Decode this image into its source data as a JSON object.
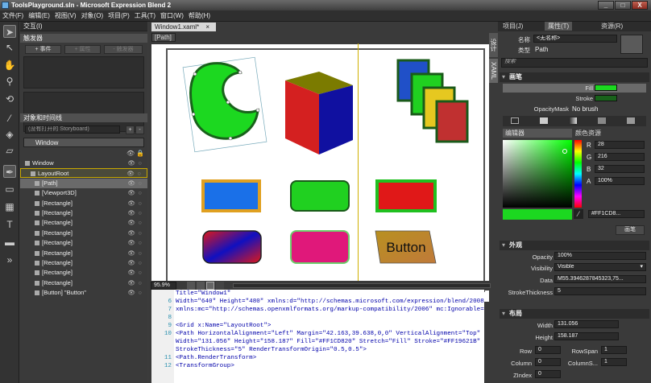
{
  "window": {
    "title": "ToolsPlayground.sln - Microsoft Expression Blend 2",
    "controls": [
      "_",
      "□",
      "X"
    ]
  },
  "menu": [
    "文件(F)",
    "编辑(E)",
    "视图(V)",
    "对象(O)",
    "项目(P)",
    "工具(T)",
    "窗口(W)",
    "帮助(H)"
  ],
  "interaction": {
    "title": "交互(I)",
    "triggers_title": "触发器",
    "event_btn": "+ 事件",
    "property_btn": "+ 属性",
    "delete_btn": "- 触发器",
    "objects_title": "对象和时间线",
    "storyboard_placeholder": "(没有打开的 Storyboard)",
    "window_label": "Window",
    "tree": [
      "Window",
      "LayoutRoot",
      "[Path]",
      "[Viewport3D]",
      "[Rectangle]",
      "[Rectangle]",
      "[Rectangle]",
      "[Rectangle]",
      "[Rectangle]",
      "[Rectangle]",
      "[Rectangle]",
      "[Rectangle]",
      "[Rectangle]",
      "[Button] \"Button\""
    ]
  },
  "document": {
    "tab": "Window1.xaml*",
    "breadcrumb": "[Path]",
    "zoom": "95.9%",
    "side_tabs": [
      "设计",
      "XAML"
    ],
    "button_text": "Button"
  },
  "xaml": {
    "lines": [
      {
        "n": "",
        "t": "Title=\"Window1\""
      },
      {
        "n": "6",
        "t": "Width=\"640\" Height=\"480\" xmlns:d=\"http://schemas.microsoft.com/expression/blend/2008\""
      },
      {
        "n": "7",
        "t": "xmlns:mc=\"http://schemas.openxmlformats.org/markup-compatibility/2006\" mc:Ignorable=\"d\">"
      },
      {
        "n": "8",
        "t": ""
      },
      {
        "n": "9",
        "t": "  <Grid x:Name=\"LayoutRoot\">"
      },
      {
        "n": "10",
        "t": "    <Path HorizontalAlignment=\"Left\" Margin=\"42.163,39.638,0,0\" VerticalAlignment=\"Top\""
      },
      {
        "n": "",
        "t": "Width=\"131.056\" Height=\"158.187\" Fill=\"#FF1CD820\" Stretch=\"Fill\" Stroke=\"#FF19621B\""
      },
      {
        "n": "",
        "t": "StrokeThickness=\"5\" RenderTransformOrigin=\"0.5,0.5\">"
      },
      {
        "n": "11",
        "t": "      <Path.RenderTransform>"
      },
      {
        "n": "12",
        "t": "        <TransformGroup>"
      }
    ]
  },
  "right_tabs": [
    "项目(J)",
    "属性(T)",
    "资源(R)"
  ],
  "properties": {
    "name_label": "名称",
    "name_value": "<无名称>",
    "type_label": "类型",
    "type_value": "Path",
    "search_placeholder": "搜索",
    "brushes": {
      "title": "画笔",
      "fill": "Fill",
      "stroke": "Stroke",
      "opacity_mask": "OpacityMask",
      "opacity_mask_value": "No brush"
    },
    "editor_tab": "编辑器",
    "color_resources_tab": "颜色资源",
    "rgba": [
      {
        "k": "R",
        "v": "28"
      },
      {
        "k": "G",
        "v": "216"
      },
      {
        "k": "B",
        "v": "32"
      },
      {
        "k": "A",
        "v": "100%"
      }
    ],
    "hex": "#FF1CD8...",
    "brush_btn": "画笔",
    "appearance": {
      "title": "外观",
      "opacity_label": "Opacity",
      "opacity_value": "100%",
      "visibility_label": "Visibility",
      "visibility_value": "Visible",
      "data_label": "Data",
      "data_value": "M55.3946287845323,75...",
      "stroke_thickness_label": "StrokeThickness",
      "stroke_thickness_value": "5"
    },
    "layout": {
      "title": "布局",
      "width_label": "Width",
      "width_value": "131.056",
      "height_label": "Height",
      "height_value": "158.187",
      "row_label": "Row",
      "row_value": "0",
      "rowspan_label": "RowSpan",
      "rowspan_value": "1",
      "column_label": "Column",
      "column_value": "0",
      "colspan_label": "ColumnS...",
      "colspan_value": "1",
      "zindex_label": "ZIndex",
      "zindex_value": "0"
    }
  },
  "colors": {
    "fill": "#1CD820",
    "stroke": "#19621B",
    "selection": "#d0b000"
  }
}
